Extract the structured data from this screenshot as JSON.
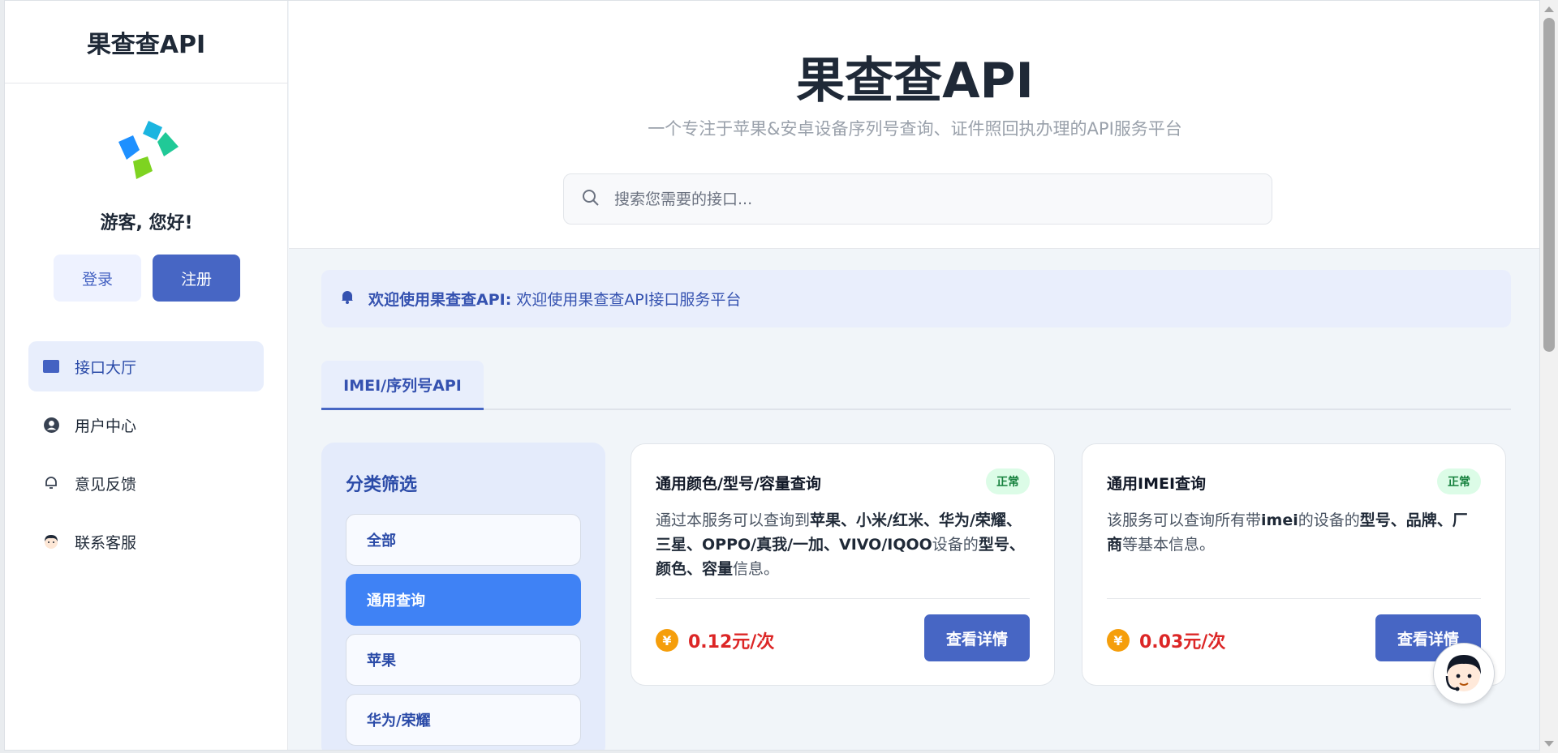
{
  "sidebar": {
    "brand": "果查查API",
    "greeting": "游客, 您好!",
    "login_label": "登录",
    "register_label": "注册",
    "nav": [
      {
        "label": "接口大厅",
        "icon": "square-icon",
        "active": true
      },
      {
        "label": "用户中心",
        "icon": "user-circle-icon",
        "active": false
      },
      {
        "label": "意见反馈",
        "icon": "feedback-icon",
        "active": false
      },
      {
        "label": "联系客服",
        "icon": "support-agent-icon",
        "active": false
      }
    ]
  },
  "header": {
    "title": "果查查API",
    "subtitle": "一个专注于苹果&安卓设备序列号查询、证件照回执办理的API服务平台",
    "search_placeholder": "搜索您需要的接口..."
  },
  "notice": {
    "label": "欢迎使用果查查API:",
    "text": "欢迎使用果查查API接口服务平台"
  },
  "tabs": [
    {
      "label": "IMEI/序列号API",
      "active": true
    }
  ],
  "filter": {
    "title": "分类筛选",
    "items": [
      {
        "label": "全部",
        "active": false
      },
      {
        "label": "通用查询",
        "active": true
      },
      {
        "label": "苹果",
        "active": false
      },
      {
        "label": "华为/荣耀",
        "active": false
      }
    ]
  },
  "cards": [
    {
      "title": "通用颜色/型号/容量查询",
      "status": "正常",
      "desc_parts": [
        {
          "t": "通过本服务可以查询到",
          "b": false
        },
        {
          "t": "苹果、小米/红米、华为/荣耀、三星、OPPO/真我/一加、VIVO/IQOO",
          "b": true
        },
        {
          "t": "设备的",
          "b": false
        },
        {
          "t": "型号、颜色、容量",
          "b": true
        },
        {
          "t": "信息。",
          "b": false
        }
      ],
      "price": "0.12元/次",
      "button": "查看详情"
    },
    {
      "title": "通用IMEI查询",
      "status": "正常",
      "desc_parts": [
        {
          "t": "该服务可以查询所有带",
          "b": false
        },
        {
          "t": "imei",
          "b": true
        },
        {
          "t": "的设备的",
          "b": false
        },
        {
          "t": "型号、品牌、厂商",
          "b": true
        },
        {
          "t": "等基本信息。",
          "b": false
        }
      ],
      "price": "0.03元/次",
      "button": "查看详情"
    }
  ],
  "colors": {
    "primary": "#4766c4",
    "active_filter": "#3f82f5",
    "price": "#dc2626",
    "status_bg": "#dcfce7",
    "status_text": "#15803d"
  }
}
